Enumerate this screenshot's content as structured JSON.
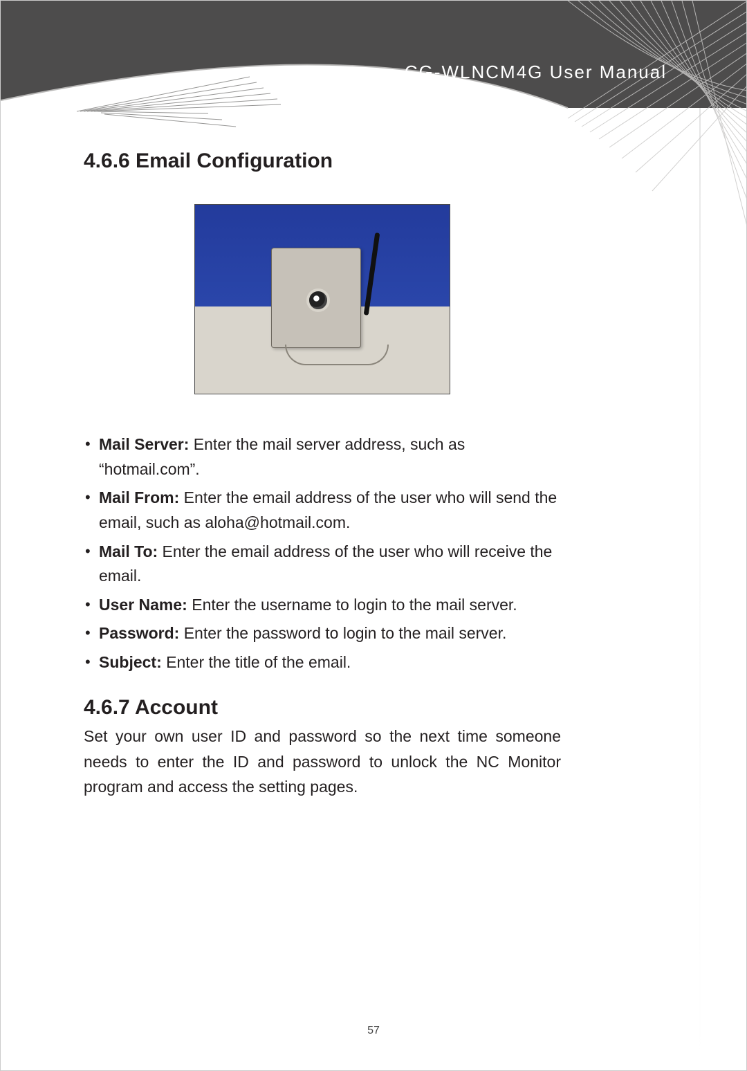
{
  "header": {
    "title": "CG-WLNCM4G User Manual"
  },
  "section1": {
    "heading": "4.6.6 Email Configuration",
    "bullets": [
      {
        "label": "Mail Server:",
        "text": " Enter the mail server address, such as “hotmail.com”."
      },
      {
        "label": "Mail From:",
        "text": " Enter the email address of the user who will send the email, such as aloha@hotmail.com."
      },
      {
        "label": "Mail To:",
        "text": " Enter the email address of the user who will receive the email."
      },
      {
        "label": "User Name:",
        "text": " Enter the username to login to the mail server."
      },
      {
        "label": "Password:",
        "text": " Enter the password to login to the mail server."
      },
      {
        "label": "Subject:",
        "text": " Enter the title of the email."
      }
    ]
  },
  "section2": {
    "heading": "4.6.7 Account",
    "body": "Set your own user ID and password so the next time someone needs to enter the ID and password to unlock the NC Monitor program and access the setting pages."
  },
  "pageNumber": "57"
}
